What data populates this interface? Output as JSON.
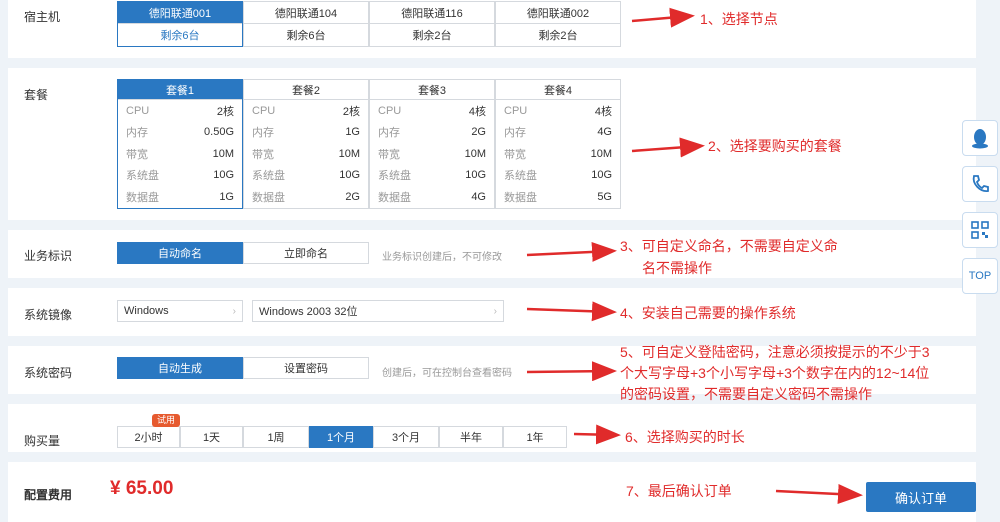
{
  "host": {
    "label": "宿主机",
    "options": [
      {
        "name": "德阳联通001",
        "remain": "剩余6台",
        "selected": true
      },
      {
        "name": "德阳联通104",
        "remain": "剩余6台",
        "selected": false
      },
      {
        "name": "德阳联通116",
        "remain": "剩余2台",
        "selected": false
      },
      {
        "name": "德阳联通002",
        "remain": "剩余2台",
        "selected": false
      }
    ]
  },
  "package": {
    "label": "套餐",
    "keys": [
      "CPU",
      "内存",
      "带宽",
      "系统盘",
      "数据盘"
    ],
    "options": [
      {
        "name": "套餐1",
        "values": [
          "2核",
          "0.50G",
          "10M",
          "10G",
          "1G"
        ],
        "selected": true
      },
      {
        "name": "套餐2",
        "values": [
          "2核",
          "1G",
          "10M",
          "10G",
          "2G"
        ],
        "selected": false
      },
      {
        "name": "套餐3",
        "values": [
          "4核",
          "2G",
          "10M",
          "10G",
          "4G"
        ],
        "selected": false
      },
      {
        "name": "套餐4",
        "values": [
          "4核",
          "4G",
          "10M",
          "10G",
          "5G"
        ],
        "selected": false
      }
    ]
  },
  "business": {
    "label": "业务标识",
    "auto_label": "自动命名",
    "manual_label": "立即命名",
    "hint": "业务标识创建后，不可修改"
  },
  "image": {
    "label": "系统镜像",
    "os_value": "Windows",
    "version_value": "Windows 2003 32位"
  },
  "password": {
    "label": "系统密码",
    "auto_label": "自动生成",
    "manual_label": "设置密码",
    "hint": "创建后，可在控制台查看密码"
  },
  "duration": {
    "label": "购买量",
    "badge": "试用",
    "options": [
      "2小时",
      "1天",
      "1周",
      "1个月",
      "3个月",
      "半年",
      "1年"
    ],
    "selected_index": 3
  },
  "footer": {
    "label": "配置费用",
    "price": "¥ 65.00",
    "confirm_label": "确认订单"
  },
  "sidebar": {
    "top_label": "TOP",
    "icons": [
      "qq-icon",
      "phone-icon",
      "qrcode-icon"
    ]
  },
  "annotations": {
    "a1": "1、选择节点",
    "a2": "2、选择要购买的套餐",
    "a3_l1": "3、可自定义命名，不需要自定义命",
    "a3_l2": "名不需操作",
    "a4": "4、安装自己需要的操作系统",
    "a5_l1": "5、可自定义登陆密码，注意必须按提示的不少于3",
    "a5_l2": "个大写字母+3个小写字母+3个数字在内的12~14位",
    "a5_l3": "的密码设置，不需要自定义密码不需操作",
    "a6": "6、选择购买的时长",
    "a7": "7、最后确认订单"
  },
  "colors": {
    "accent": "#2a78c2",
    "annotation": "#e02b2b",
    "price": "#e02b2b"
  }
}
